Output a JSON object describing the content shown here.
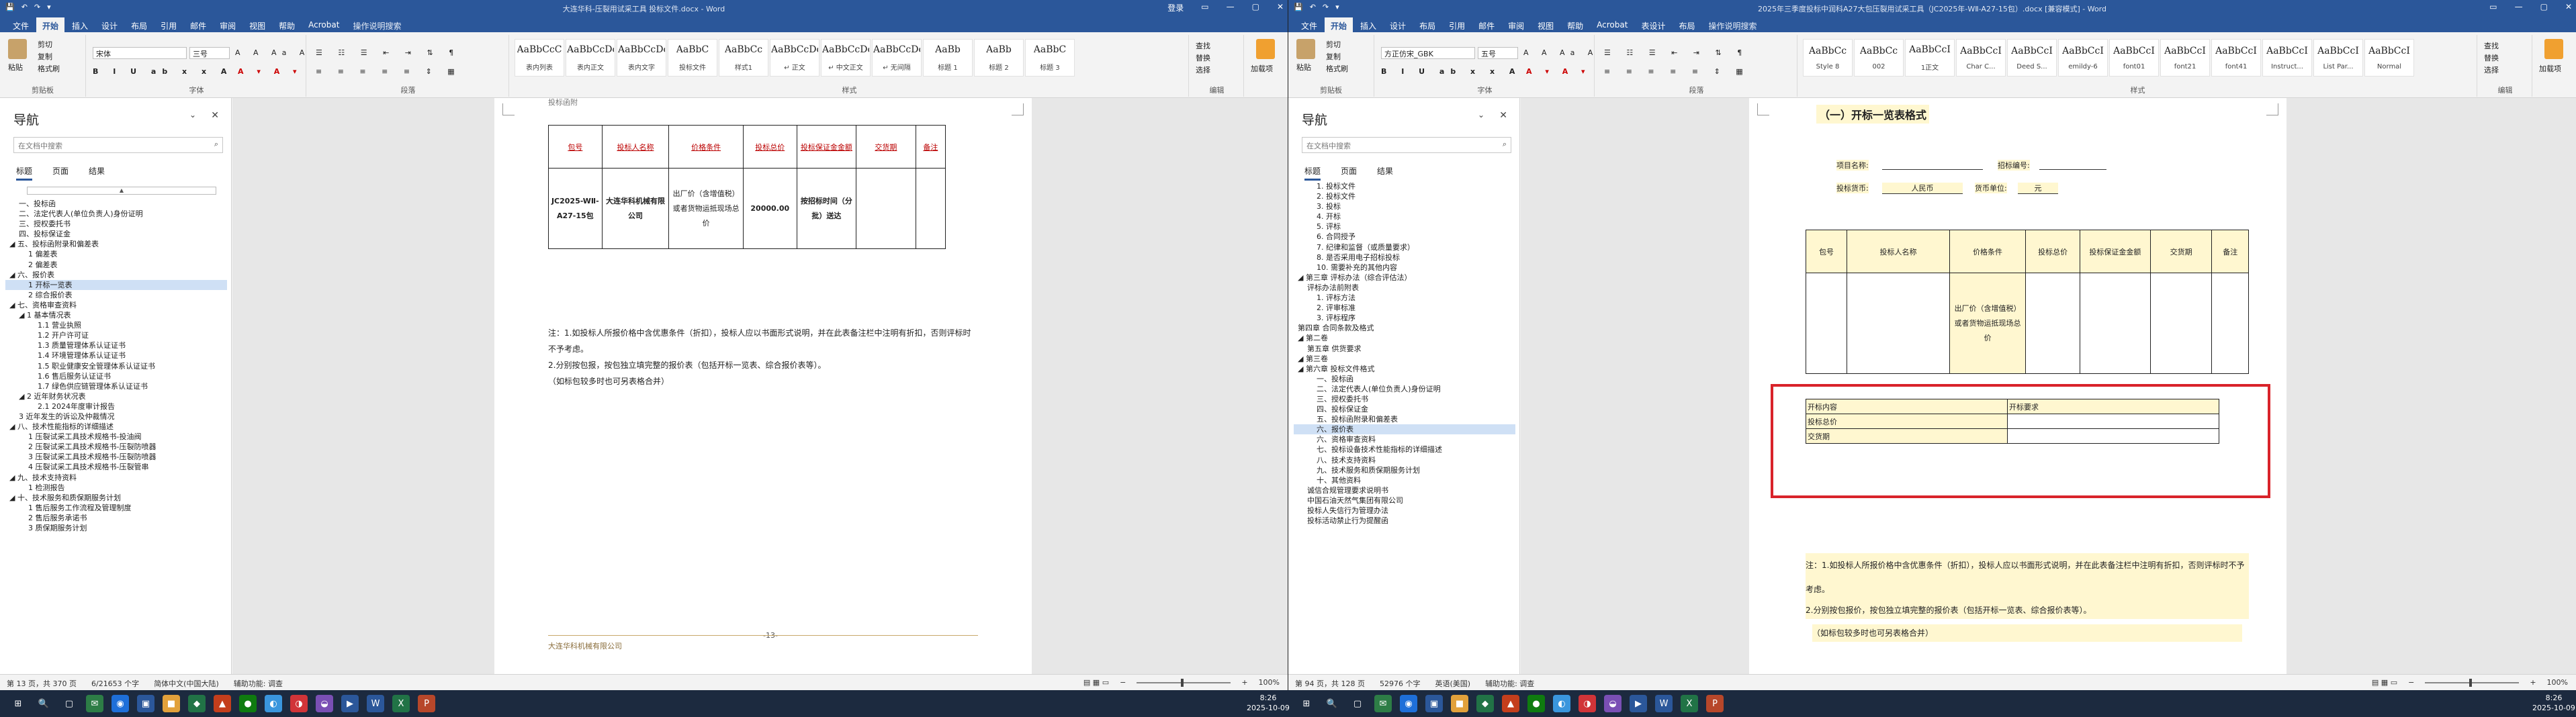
{
  "w1": {
    "qat": [
      "💾",
      "↶",
      "↷",
      "▾"
    ],
    "title": "大连华科-压裂用试采工具 投标文件.docx - Word",
    "controls": [
      "登录",
      "▭",
      "—",
      "▢",
      "✕"
    ],
    "tabs": [
      "文件",
      "开始",
      "插入",
      "设计",
      "布局",
      "引用",
      "邮件",
      "审阅",
      "视图",
      "帮助",
      "Acrobat",
      "操作说明搜索"
    ],
    "clip": {
      "paste": "粘贴",
      "cut": "剪切",
      "copy": "复制",
      "fmt": "格式刷",
      "label": "剪贴板"
    },
    "font": {
      "name": "宋体",
      "size": "三号",
      "label": "字体"
    },
    "para": {
      "label": "段落"
    },
    "styles": {
      "label": "样式",
      "items": [
        {
          "p": "AaBbCcC",
          "n": "表内列表"
        },
        {
          "p": "AaBbCcDc",
          "n": "表内正文"
        },
        {
          "p": "AaBbCcDc",
          "n": "表内文字"
        },
        {
          "p": "AaBbC",
          "n": "投标文件"
        },
        {
          "p": "AaBbCc",
          "n": "样式1"
        },
        {
          "p": "AaBbCcDc",
          "n": "↵ 正文"
        },
        {
          "p": "AaBbCcDc",
          "n": "↵ 中文正文"
        },
        {
          "p": "AaBbCcDc",
          "n": "↵ 无间隔"
        },
        {
          "p": "AaBb",
          "n": "标题 1"
        },
        {
          "p": "AaBb",
          "n": "标题 2"
        },
        {
          "p": "AaBbC",
          "n": "标题 3"
        }
      ]
    },
    "edit": {
      "find": "查找",
      "replace": "替换",
      "select": "选择",
      "label": "编辑"
    },
    "addin": {
      "b": "加载项",
      "label": "加载项"
    },
    "nav": {
      "title": "导航",
      "search": "在文档中搜索",
      "tabs": [
        "标题",
        "页面",
        "结果"
      ],
      "items": [
        {
          "t": "一、投标函",
          "l": 1
        },
        {
          "t": "二、法定代表人(单位负责人)身份证明",
          "l": 1
        },
        {
          "t": "三、授权委托书",
          "l": 1
        },
        {
          "t": "四、投标保证金",
          "l": 1
        },
        {
          "t": "◢ 五、投标函附录和偏差表",
          "l": 0
        },
        {
          "t": "1 偏差表",
          "l": 2
        },
        {
          "t": "2 偏差表",
          "l": 2
        },
        {
          "t": "◢ 六、报价表",
          "l": 0
        },
        {
          "t": "1 开标一览表",
          "l": 2,
          "sel": true
        },
        {
          "t": "2 综合报价表",
          "l": 2
        },
        {
          "t": "◢ 七、资格审查资料",
          "l": 0
        },
        {
          "t": "◢ 1 基本情况表",
          "l": 1
        },
        {
          "t": "1.1 营业执照",
          "l": 3
        },
        {
          "t": "1.2 开户许可证",
          "l": 3
        },
        {
          "t": "1.3 质量管理体系认证证书",
          "l": 3
        },
        {
          "t": "1.4 环境管理体系认证证书",
          "l": 3
        },
        {
          "t": "1.5 职业健康安全管理体系认证证书",
          "l": 3
        },
        {
          "t": "1.6 售后服务认证证书",
          "l": 3
        },
        {
          "t": "1.7 绿色供应链管理体系认证证书",
          "l": 3
        },
        {
          "t": "◢ 2 近年财务状况表",
          "l": 1
        },
        {
          "t": "2.1 2024年度审计报告",
          "l": 3
        },
        {
          "t": "3 近年发生的诉讼及仲裁情况",
          "l": 1
        },
        {
          "t": "◢ 八、技术性能指标的详细描述",
          "l": 0
        },
        {
          "t": "1 压裂试采工具技术规格书-投油阀",
          "l": 2
        },
        {
          "t": "2 压裂试采工具技术规格书-压裂防喷器",
          "l": 2
        },
        {
          "t": "3 压裂试采工具技术规格书-压裂防喷器",
          "l": 2
        },
        {
          "t": "4 压裂试采工具技术规格书-压裂管串",
          "l": 2
        },
        {
          "t": "◢ 九、技术支持资料",
          "l": 0
        },
        {
          "t": "1 检测报告",
          "l": 2
        },
        {
          "t": "◢ 十、技术服务和质保期服务计划",
          "l": 0
        },
        {
          "t": "1 售后服务工作流程及管理制度",
          "l": 2
        },
        {
          "t": "2 售后服务承诺书",
          "l": 2
        },
        {
          "t": "3 质保期服务计划",
          "l": 2
        }
      ]
    },
    "page": {
      "above": "投标函附",
      "headers": [
        "包号",
        "投标人名称",
        "价格条件",
        "投标总价",
        "投标保证金金额",
        "交货期",
        "备注"
      ],
      "row": [
        "JC2025-WⅡ-A27-15包",
        "大连华科机械有限公司",
        "出厂价（含增值税）或者货物运抵现场总价",
        "20000.00",
        "按招标时间（分批）送达",
        ""
      ],
      "note1": "注：1.如投标人所报价格中含优惠条件（折扣），投标人应以书面形式说明，并在此表备注栏中注明有折扣，否则评标时不予考虑。",
      "note2": "2.分别按包报，按包独立填完整的报价表（包括开标一览表、综合报价表等）。",
      "note3": "（如标包较多时也可另表格合并）",
      "footer": "大连华科机械有限公司",
      "pageno": "-13-"
    },
    "status": {
      "left": [
        "第 13 页，共 370 页",
        "6/21653 个字",
        "简体中文(中国大陆)",
        "辅助功能: 调查"
      ],
      "right": [
        "100%"
      ]
    }
  },
  "w2": {
    "qat": [
      "💾",
      "↶",
      "↷",
      "▾"
    ],
    "title": "2025年三季度投标中润科A27大包压裂用试采工具（JC2025年-WⅡ-A27-15包）.docx [兼容模式] - Word",
    "controls": [
      "▭",
      "—",
      "▢",
      "✕"
    ],
    "tabs": [
      "文件",
      "开始",
      "插入",
      "设计",
      "布局",
      "引用",
      "邮件",
      "审阅",
      "视图",
      "帮助",
      "Acrobat",
      "表设计",
      "布局",
      "操作说明搜索"
    ],
    "font": {
      "name": "方正仿宋_GBK",
      "size": "五号",
      "label": "字体"
    },
    "para": {
      "label": "段落"
    },
    "styles": {
      "label": "样式",
      "items": [
        {
          "p": "AaBbCc",
          "n": "Style 8"
        },
        {
          "p": "AaBbCc",
          "n": "002"
        },
        {
          "p": "AaBbCcI",
          "n": "1正文"
        },
        {
          "p": "AaBbCcI",
          "n": "Char C..."
        },
        {
          "p": "AaBbCcI",
          "n": "Deed S..."
        },
        {
          "p": "AaBbCcI",
          "n": "emildy-6"
        },
        {
          "p": "AaBbCcI",
          "n": "font01"
        },
        {
          "p": "AaBbCcI",
          "n": "font21"
        },
        {
          "p": "AaBbCcI",
          "n": "font41"
        },
        {
          "p": "AaBbCcI",
          "n": "Instruct..."
        },
        {
          "p": "AaBbCcI",
          "n": "List Par..."
        },
        {
          "p": "AaBbCcI",
          "n": "Normal"
        }
      ]
    },
    "edit": {
      "find": "查找",
      "replace": "替换",
      "select": "选择",
      "label": "编辑"
    },
    "nav": {
      "title": "导航",
      "search": "在文档中搜索",
      "tabs": [
        "标题",
        "页面",
        "结果"
      ],
      "items": [
        {
          "t": "1. 投标文件",
          "l": 2
        },
        {
          "t": "2. 投标文件",
          "l": 2
        },
        {
          "t": "3. 投标",
          "l": 2
        },
        {
          "t": "4. 开标",
          "l": 2
        },
        {
          "t": "5. 评标",
          "l": 2
        },
        {
          "t": "6. 合同授予",
          "l": 2
        },
        {
          "t": "7. 纪律和监督（或质量要求）",
          "l": 2
        },
        {
          "t": "8. 是否采用电子招标投标",
          "l": 2
        },
        {
          "t": "10. 需要补充的其他内容",
          "l": 2
        },
        {
          "t": "◢ 第三章  评标办法（综合评估法）",
          "l": 0
        },
        {
          "t": "评标办法前附表",
          "l": 1
        },
        {
          "t": "1. 评标方法",
          "l": 2
        },
        {
          "t": "2. 评审标准",
          "l": 2
        },
        {
          "t": "3. 评标程序",
          "l": 2
        },
        {
          "t": "第四章  合同条款及格式",
          "l": 0
        },
        {
          "t": "◢ 第二卷",
          "l": 0
        },
        {
          "t": "第五章  供货要求",
          "l": 1
        },
        {
          "t": "◢ 第三卷",
          "l": 0
        },
        {
          "t": "◢ 第六章  投标文件格式",
          "l": 0
        },
        {
          "t": "一、投标函",
          "l": 2
        },
        {
          "t": "二、法定代表人(单位负责人)身份证明",
          "l": 2
        },
        {
          "t": "三、授权委托书",
          "l": 2
        },
        {
          "t": "四、投标保证金",
          "l": 2
        },
        {
          "t": "五、投标函附录和偏差表",
          "l": 2
        },
        {
          "t": "六、报价表",
          "l": 2,
          "sel": true
        },
        {
          "t": "六、资格审查资料",
          "l": 2
        },
        {
          "t": "七、投标设备技术性能指标的详细描述",
          "l": 2
        },
        {
          "t": "八、技术支持资料",
          "l": 2
        },
        {
          "t": "九、技术服务和质保期服务计划",
          "l": 2
        },
        {
          "t": "十、其他资料",
          "l": 2
        },
        {
          "t": "诚信合规管理要求说明书",
          "l": 1
        },
        {
          "t": "中国石油天然气集团有限公司",
          "l": 1
        },
        {
          "t": "投标人失信行为管理办法",
          "l": 1
        },
        {
          "t": "投标活动禁止行为提醒函",
          "l": 1
        }
      ]
    },
    "page": {
      "heading": "（一）开标一览表格式",
      "projname": "项目名称:",
      "bidno": "招标编号:",
      "currency": "投标货币:",
      "currency_val": "人民币",
      "unit": "货币单位:",
      "unit_val": "元",
      "headers": [
        "包号",
        "投标人名称",
        "价格条件",
        "投标总价",
        "投标保证金金额",
        "交货期",
        "备注"
      ],
      "price_cond": "出厂价（含增值税）或者货物运抵现场总价",
      "small": [
        [
          "开标内容",
          "开标要求"
        ],
        [
          "投标总价",
          ""
        ],
        [
          "交货期",
          ""
        ]
      ],
      "note1": "注：1.如投标人所报价格中含优惠条件（折扣），投标人应以书面形式说明，并在此表备注栏中注明有折扣，否则评标时不予考虑。",
      "note2": "2.分别按包报价，按包独立填完整的报价表（包括开标一览表、综合报价表等）。",
      "note3": "（如标包较多时也可另表格合并）",
      "highlight_color": "#d9232a"
    },
    "status": {
      "left": [
        "第 94 页，共 128 页",
        "52976 个字",
        "英语(美国)",
        "辅助功能: 调查"
      ],
      "right": [
        "100%"
      ]
    }
  },
  "taskbar": {
    "icons": [
      "⊞",
      "🔍",
      "▢",
      "✉",
      "◉",
      "▣",
      "■",
      "◆",
      "▲",
      "●",
      "◐",
      "◑",
      "◒",
      "▶",
      "W",
      "X",
      "P"
    ],
    "clock1": {
      "time": "8:26",
      "date": "2025-10-09"
    },
    "clock2": {
      "time": "8:26",
      "date": "2025-10-09"
    }
  },
  "colors": {
    "accent": "#2b579a",
    "selected": "#cfe0f5",
    "red_box": "#d9232a"
  }
}
